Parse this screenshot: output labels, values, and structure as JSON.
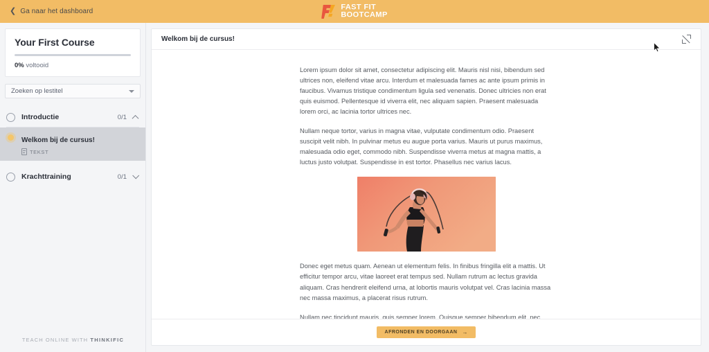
{
  "topbar": {
    "back_label": "Ga naar het dashboard",
    "back_icon": "chevron-left-icon",
    "background_color": "#f2bc65",
    "logo": {
      "mark_icon": "fast-fit-f-logo",
      "line1": "FAST FIT",
      "line2": "BOOTCAMP",
      "mark_color": "#e8563f",
      "mark_accent_color": "#f5a623"
    }
  },
  "sidebar": {
    "course_title": "Your First Course",
    "progress_percent": 0,
    "progress_value_label": "0%",
    "progress_suffix": " voltooid",
    "search": {
      "label": "Zoeken op lestitel",
      "icon": "chevron-down-icon"
    },
    "sections": [
      {
        "name": "Introductie",
        "count": "0/1",
        "status_icon": "circle-outline-icon",
        "toggle_icon": "chevron-up-icon",
        "expanded": true
      },
      {
        "name": "Krachttraining",
        "count": "0/1",
        "status_icon": "circle-outline-icon",
        "toggle_icon": "chevron-down-icon",
        "expanded": false
      }
    ],
    "lesson": {
      "name": "Welkom bij de cursus!",
      "type_label": "TEKST",
      "type_icon": "document-icon",
      "status_icon": "current-dot-icon",
      "active": true
    },
    "footer": {
      "prefix": "TEACH ONLINE WITH ",
      "brand": "THINKIFIC"
    }
  },
  "main": {
    "header": {
      "title": "Welkom bij de cursus!",
      "expand_icon": "fullscreen-expand-icon"
    },
    "paragraphs": [
      "Lorem ipsum dolor sit amet, consectetur adipiscing elit. Mauris nisl nisi, bibendum sed ultrices non, eleifend vitae arcu. Interdum et malesuada fames ac ante ipsum primis in faucibus. Vivamus tristique condimentum ligula sed venenatis. Donec ultricies non erat quis euismod. Pellentesque id viverra elit, nec aliquam sapien. Praesent malesuada lorem orci, ac lacinia tortor ultrices nec.",
      "Nullam neque tortor, varius in magna vitae, vulputate condimentum odio. Praesent suscipit velit nibh. In pulvinar metus eu augue porta varius. Mauris ut purus maximus, malesuada odio eget, commodo nibh. Suspendisse viverra metus at magna mattis, a luctus justo volutpat. Suspendisse in est tortor. Phasellus nec varius lacus."
    ],
    "image": {
      "alt": "Vrouw met koptelefoon springtouwt voor koraalkleurige achtergrond",
      "name": "lesson-hero-image"
    },
    "paragraphs_after": [
      "Donec eget metus quam. Aenean ut elementum felis. In finibus fringilla elit a mattis. Ut efficitur tempor arcu, vitae laoreet erat tempus sed. Nullam rutrum ac lectus gravida aliquam. Cras hendrerit eleifend urna, at lobortis mauris volutpat vel. Cras lacinia massa nec massa maximus, a placerat risus rutrum.",
      "Nullam nec tincidunt mauris, quis semper lorem. Quisque semper bibendum elit, nec luctus sem suscipit sed. Fusce pretium enim ac tristique venenatis. Sed vitae tincidunt libero. Morbi augue lectus, tempor ut faucibus eget, pretium nec risus."
    ],
    "cta": {
      "label": "AFRONDEN EN DOORGAAN",
      "arrow": "→",
      "color": "#f2bc65"
    }
  }
}
